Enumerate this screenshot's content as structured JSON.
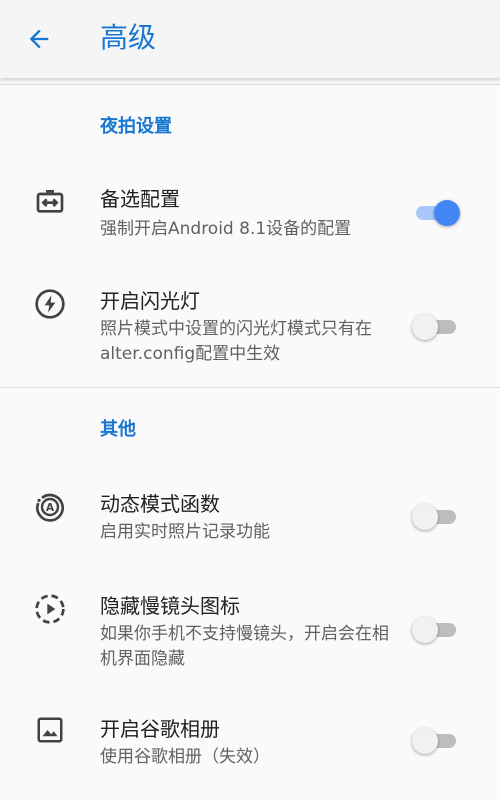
{
  "appbar": {
    "title": "高级",
    "back_icon": "arrow-back-icon"
  },
  "colors": {
    "accent": "#1976d2",
    "switch_on": "#4285f4",
    "switch_off_thumb": "#f1f1f1"
  },
  "sections": [
    {
      "header": "夜拍设置",
      "items": [
        {
          "icon": "settings-ethernet-icon",
          "title": "备选配置",
          "summary": "强制开启Android 8.1设备的配置",
          "enabled": true
        },
        {
          "icon": "flash-icon",
          "title": "开启闪光灯",
          "summary": "照片模式中设置的闪光灯模式只有在alter.config配置中生效",
          "enabled": false
        }
      ]
    },
    {
      "header": "其他",
      "items": [
        {
          "icon": "motion-photo-auto-icon",
          "title": "动态模式函数",
          "summary": "启用实时照片记录功能",
          "enabled": false
        },
        {
          "icon": "slow-motion-icon",
          "title": "隐藏慢镜头图标",
          "summary": "如果你手机不支持慢镜头，开启会在相机界面隐藏",
          "enabled": false
        },
        {
          "icon": "image-icon",
          "title": "开启谷歌相册",
          "summary": "使用谷歌相册（失效）",
          "enabled": false
        }
      ]
    }
  ]
}
